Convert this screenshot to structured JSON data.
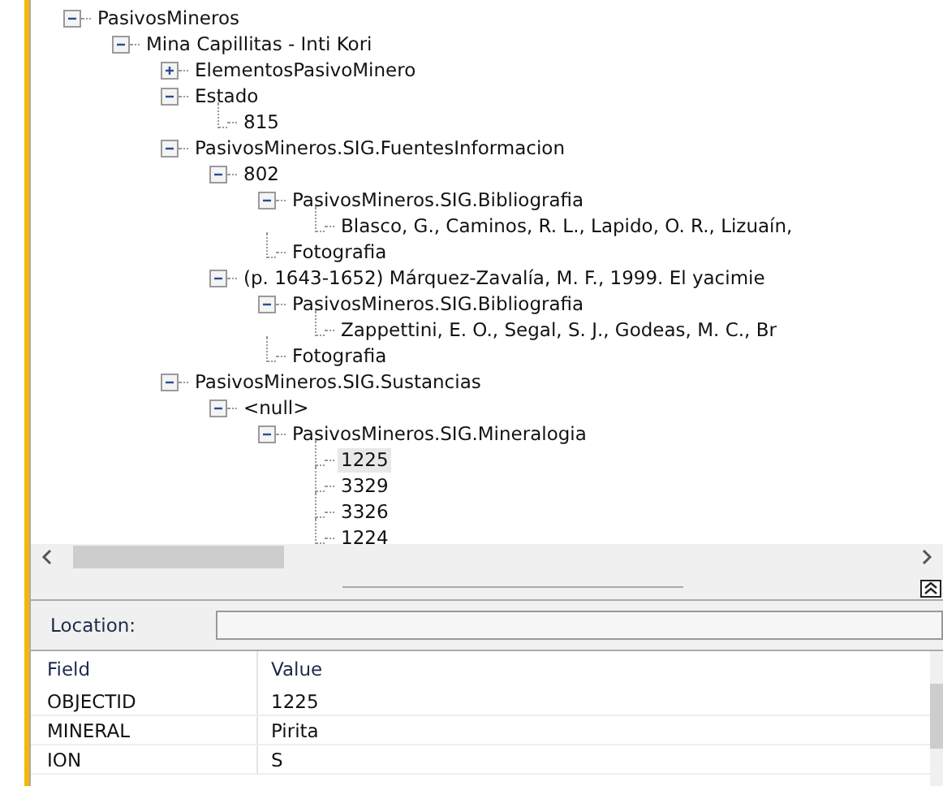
{
  "tree": [
    {
      "label": "PasivosMineros",
      "expanded": true,
      "selected": false,
      "children": [
        {
          "label": "Mina Capillitas - Inti Kori",
          "expanded": true,
          "selected": false,
          "children": [
            {
              "label": "ElementosPasivoMinero",
              "expanded": false,
              "selected": false
            },
            {
              "label": "Estado",
              "expanded": true,
              "selected": false,
              "children": [
                {
                  "label": "815",
                  "selected": false
                }
              ]
            },
            {
              "label": "PasivosMineros.SIG.FuentesInformacion",
              "expanded": true,
              "selected": false,
              "children": [
                {
                  "label": "802",
                  "expanded": true,
                  "selected": false,
                  "children": [
                    {
                      "label": "PasivosMineros.SIG.Bibliografia",
                      "expanded": true,
                      "selected": false,
                      "children": [
                        {
                          "label": "Blasco, G., Caminos, R. L., Lapido, O. R., Lizuaín,",
                          "selected": false
                        }
                      ]
                    },
                    {
                      "label": "Fotografia",
                      "selected": false
                    }
                  ]
                },
                {
                  "label": "(p. 1643-1652) Márquez-Zavalía, M. F., 1999. El yacimie",
                  "expanded": true,
                  "selected": false,
                  "children": [
                    {
                      "label": "PasivosMineros.SIG.Bibliografia",
                      "expanded": true,
                      "selected": false,
                      "children": [
                        {
                          "label": "Zappettini, E. O., Segal, S. J., Godeas, M. C., Br",
                          "selected": false
                        }
                      ]
                    },
                    {
                      "label": "Fotografia",
                      "selected": false
                    }
                  ]
                }
              ]
            },
            {
              "label": "PasivosMineros.SIG.Sustancias",
              "expanded": true,
              "selected": false,
              "children": [
                {
                  "label": "<null>",
                  "expanded": true,
                  "selected": false,
                  "children": [
                    {
                      "label": "PasivosMineros.SIG.Mineralogia",
                      "expanded": true,
                      "selected": false,
                      "children": [
                        {
                          "label": "1225",
                          "selected": true
                        },
                        {
                          "label": "3329",
                          "selected": false
                        },
                        {
                          "label": "3326",
                          "selected": false
                        },
                        {
                          "label": "1224",
                          "selected": false
                        }
                      ]
                    }
                  ]
                }
              ]
            }
          ]
        }
      ]
    }
  ],
  "location": {
    "label": "Location:"
  },
  "table": {
    "columns": [
      "Field",
      "Value"
    ],
    "rows": [
      [
        "OBJECTID",
        "1225"
      ],
      [
        "MINERAL",
        "Pirita"
      ],
      [
        "ION",
        "S"
      ]
    ]
  }
}
